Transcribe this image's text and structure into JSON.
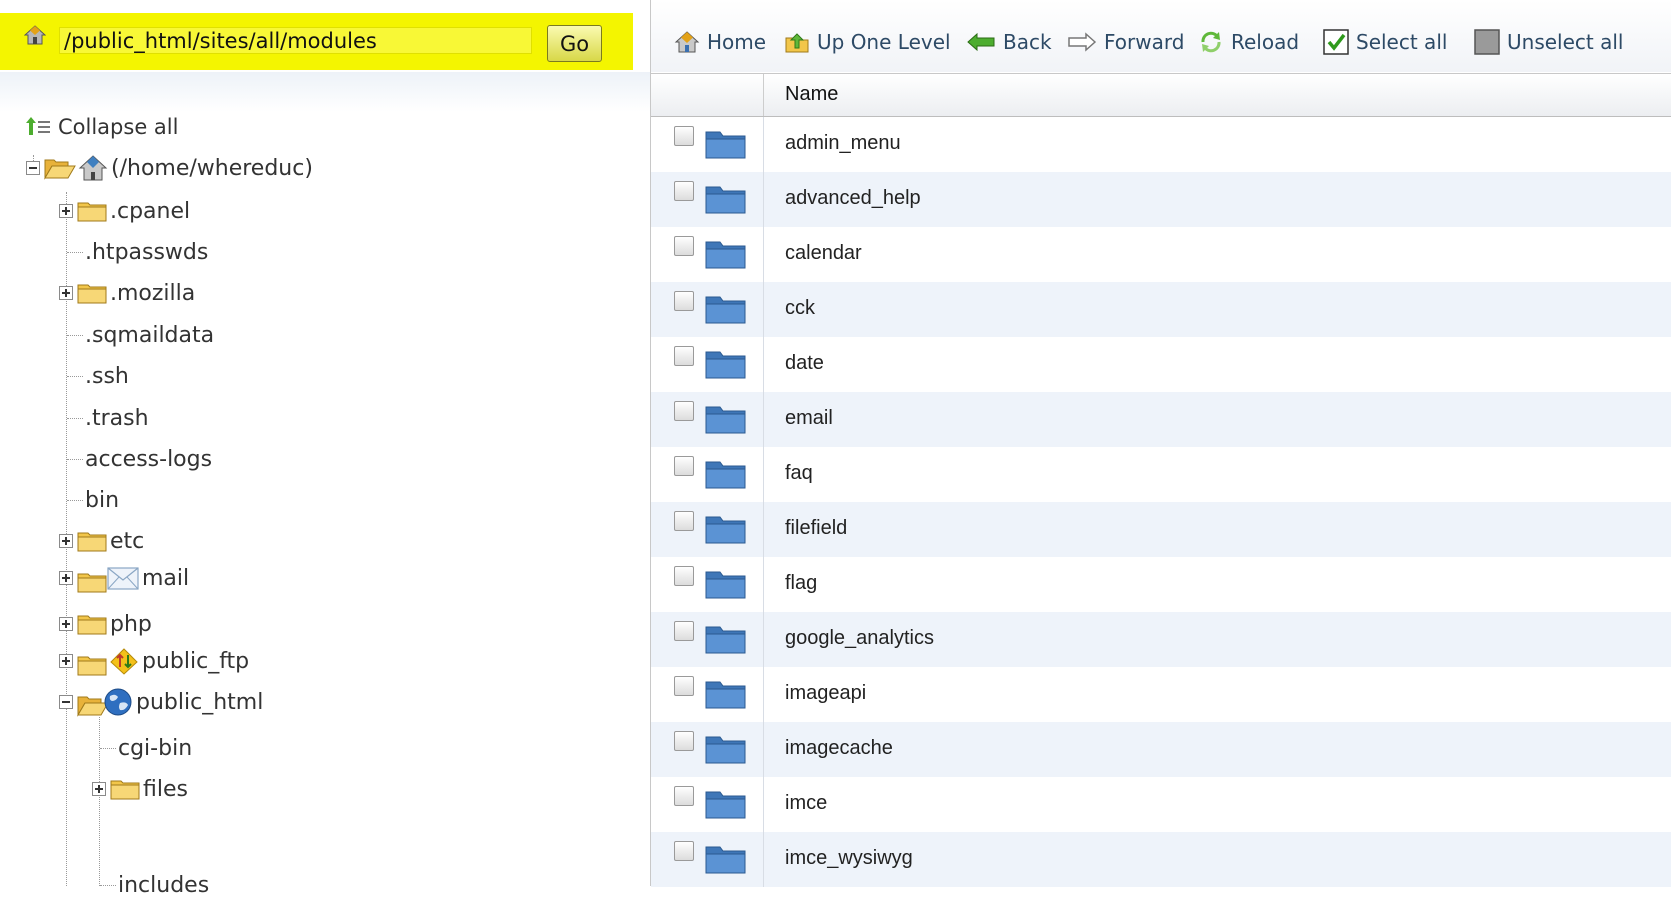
{
  "path_bar": {
    "path_value": "/public_html/sites/all/modules",
    "go_label": "Go",
    "highlight_color": "#f4f500"
  },
  "toolbar": {
    "items": [
      {
        "label": "Home",
        "icon": "home-icon"
      },
      {
        "label": "Up One Level",
        "icon": "up-level-icon"
      },
      {
        "label": "Back",
        "icon": "back-arrow-icon"
      },
      {
        "label": "Forward",
        "icon": "forward-arrow-icon"
      },
      {
        "label": "Reload",
        "icon": "reload-icon"
      },
      {
        "label": "Select all",
        "icon": "checkbox-checked-icon"
      },
      {
        "label": "Unselect all",
        "icon": "checkbox-unchecked-icon"
      }
    ]
  },
  "tree": {
    "collapse_all_label": "Collapse all",
    "nodes": [
      {
        "label": "(/home/whereduc)",
        "icon": "home-icon",
        "toggle": "minus"
      },
      {
        "label": ".cpanel",
        "icon": "folder-icon",
        "toggle": "plus"
      },
      {
        "label": ".htpasswds",
        "icon": "",
        "toggle": "none"
      },
      {
        "label": ".mozilla",
        "icon": "folder-icon",
        "toggle": "plus"
      },
      {
        "label": ".sqmaildata",
        "icon": "",
        "toggle": "none"
      },
      {
        "label": ".ssh",
        "icon": "",
        "toggle": "none"
      },
      {
        "label": ".trash",
        "icon": "",
        "toggle": "none"
      },
      {
        "label": "access-logs",
        "icon": "",
        "toggle": "none"
      },
      {
        "label": "bin",
        "icon": "",
        "toggle": "none"
      },
      {
        "label": "etc",
        "icon": "folder-icon",
        "toggle": "plus"
      },
      {
        "label": "mail",
        "icon": "mail-envelope-icon",
        "toggle": "plus"
      },
      {
        "label": "php",
        "icon": "folder-icon",
        "toggle": "plus"
      },
      {
        "label": "public_ftp",
        "icon": "ftp-arrows-icon",
        "toggle": "plus"
      },
      {
        "label": "public_html",
        "icon": "globe-icon",
        "toggle": "minus"
      },
      {
        "label": "cgi-bin",
        "icon": "",
        "toggle": "none"
      },
      {
        "label": "files",
        "icon": "folder-icon",
        "toggle": "plus"
      },
      {
        "label": "includes",
        "icon": "",
        "toggle": "none"
      }
    ]
  },
  "file_list": {
    "name_header": "Name",
    "files": [
      "admin_menu",
      "advanced_help",
      "calendar",
      "cck",
      "date",
      "email",
      "faq",
      "filefield",
      "flag",
      "google_analytics",
      "imageapi",
      "imagecache",
      "imce",
      "imce_wysiwyg"
    ]
  },
  "colors": {
    "row_alt_background": "#eef3fa",
    "toolbar_text": "#2d4a66",
    "folder_yellow": "#f2c64a",
    "folder_blue": "#4f86c6"
  }
}
